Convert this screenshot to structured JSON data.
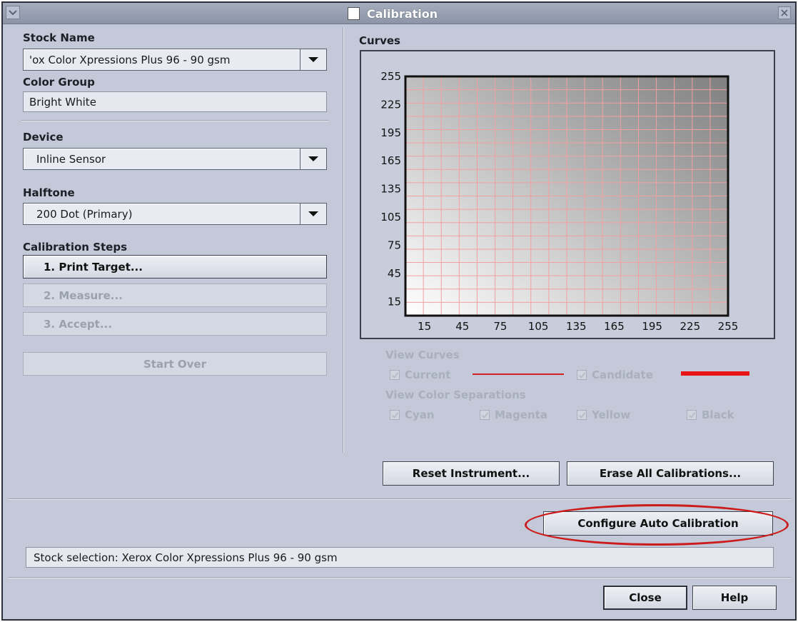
{
  "window": {
    "title": "Calibration"
  },
  "left": {
    "stock_name_label": "Stock Name",
    "stock_name_value": "'ox Color Xpressions Plus 96 - 90 gsm",
    "color_group_label": "Color Group",
    "color_group_value": "Bright White",
    "device_label": "Device",
    "device_value": "Inline Sensor",
    "halftone_label": "Halftone",
    "halftone_value": "200 Dot (Primary)",
    "steps_label": "Calibration Steps",
    "step1": "1. Print Target...",
    "step2": "2. Measure...",
    "step3": "3. Accept...",
    "start_over": "Start Over"
  },
  "right": {
    "curves_label": "Curves",
    "view_curves_label": "View Curves",
    "current_label": "Current",
    "candidate_label": "Candidate",
    "view_separations_label": "View Color Separations",
    "cyan_label": "Cyan",
    "magenta_label": "Magenta",
    "yellow_label": "Yellow",
    "black_label": "Black",
    "reset_instrument": "Reset Instrument...",
    "erase_all": "Erase All Calibrations..."
  },
  "configure_auto": "Configure Auto Calibration",
  "status_text": "Stock selection:  Xerox Color Xpressions Plus 96 - 90 gsm",
  "footer": {
    "close": "Close",
    "help": "Help"
  },
  "colors": {
    "current_curve": "#d42020",
    "candidate_curve": "#e81515",
    "grid": "#f2a0a0",
    "highlight": "#cc1b1b"
  },
  "chart_data": {
    "type": "line",
    "title": "",
    "xlabel": "",
    "ylabel": "",
    "xlim": [
      0,
      255
    ],
    "ylim": [
      0,
      255
    ],
    "x_ticks": [
      15,
      45,
      75,
      105,
      135,
      165,
      195,
      225,
      255
    ],
    "y_ticks": [
      15,
      45,
      75,
      105,
      135,
      165,
      195,
      225,
      255
    ],
    "grid": true,
    "series": []
  }
}
